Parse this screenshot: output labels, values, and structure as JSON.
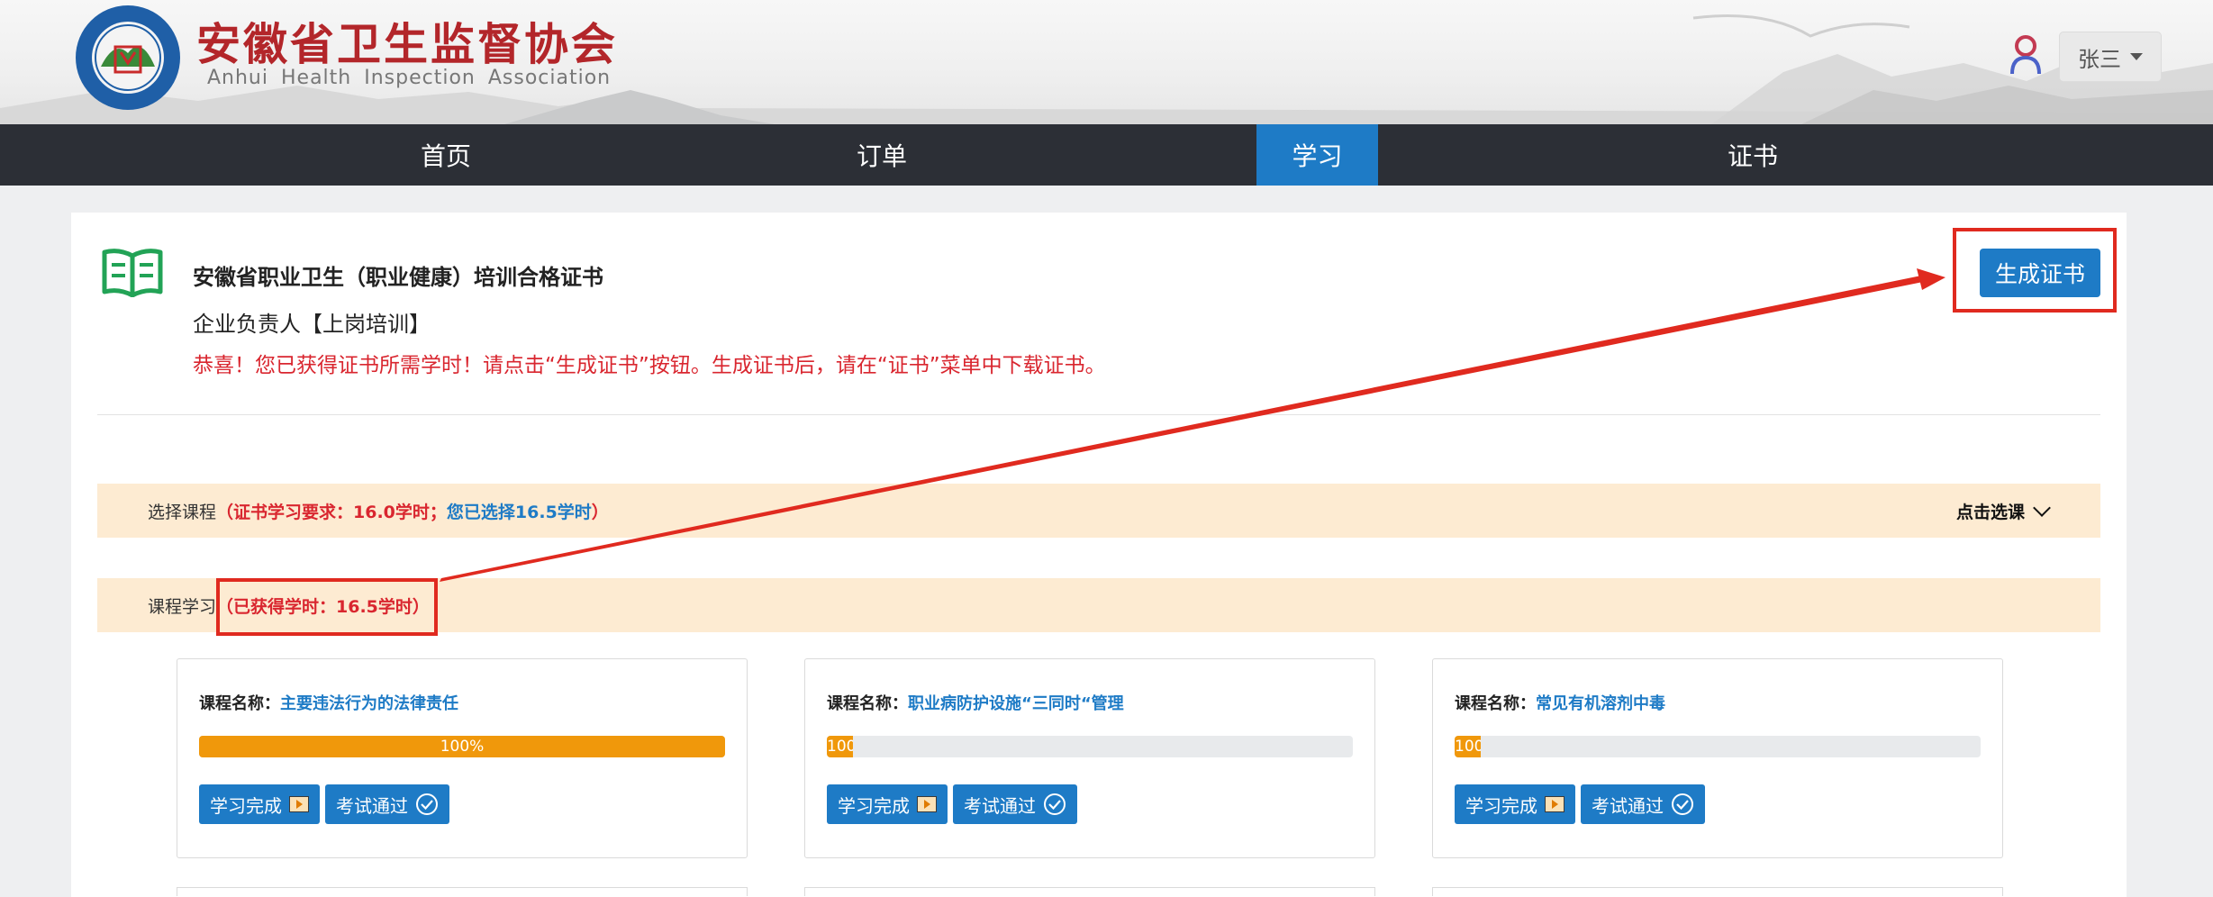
{
  "header": {
    "org_name_cn": "安徽省卫生监督协会",
    "org_name_en": "Anhui  Health  Inspection  Association",
    "user_name": "张三"
  },
  "nav": {
    "items": [
      {
        "label": "首页",
        "active": false
      },
      {
        "label": "订单",
        "active": false
      },
      {
        "label": "学习",
        "active": true
      },
      {
        "label": "证书",
        "active": false
      }
    ]
  },
  "certificate": {
    "title": "安徽省职业卫生（职业健康）培训合格证书",
    "subtitle": "企业负责人【上岗培训】",
    "message": "恭喜！您已获得证书所需学时！请点击“生成证书”按钮。生成证书后，请在“证书”菜单中下载证书。",
    "generate_button": "生成证书"
  },
  "select_course_bar": {
    "label": "选择课程",
    "requirement_prefix": "（证书学习要求：16.0学时；",
    "selected_text": "您已选择16.5学时",
    "requirement_suffix": "）",
    "action": "点击选课"
  },
  "study_bar": {
    "label": "课程学习",
    "earned": "（已获得学时：16.5学时）"
  },
  "courses": [
    {
      "name_label": "课程名称：",
      "name": "主要违法行为的法律责任",
      "progress_text": "100%",
      "progress": 1.0,
      "study_status": "学习完成",
      "exam_status": "考试通过"
    },
    {
      "name_label": "课程名称：",
      "name": "职业病防护设施“三同时“管理",
      "progress_text": "100%",
      "progress": 0.05,
      "study_status": "学习完成",
      "exam_status": "考试通过"
    },
    {
      "name_label": "课程名称：",
      "name": "常见有机溶剂中毒",
      "progress_text": "100%",
      "progress": 0.05,
      "study_status": "学习完成",
      "exam_status": "考试通过"
    }
  ],
  "colors": {
    "brand_red": "#b3262a",
    "accent_blue": "#1e7bc6",
    "nav_dark": "#2c2f36",
    "alert_red": "#d9262f",
    "progress_orange": "#f0980b",
    "annotation_red": "#e02a1f"
  },
  "icons": [
    "logo-seal",
    "user-icon",
    "book-icon",
    "play-icon",
    "check-circle-icon",
    "chevron-down-icon"
  ]
}
